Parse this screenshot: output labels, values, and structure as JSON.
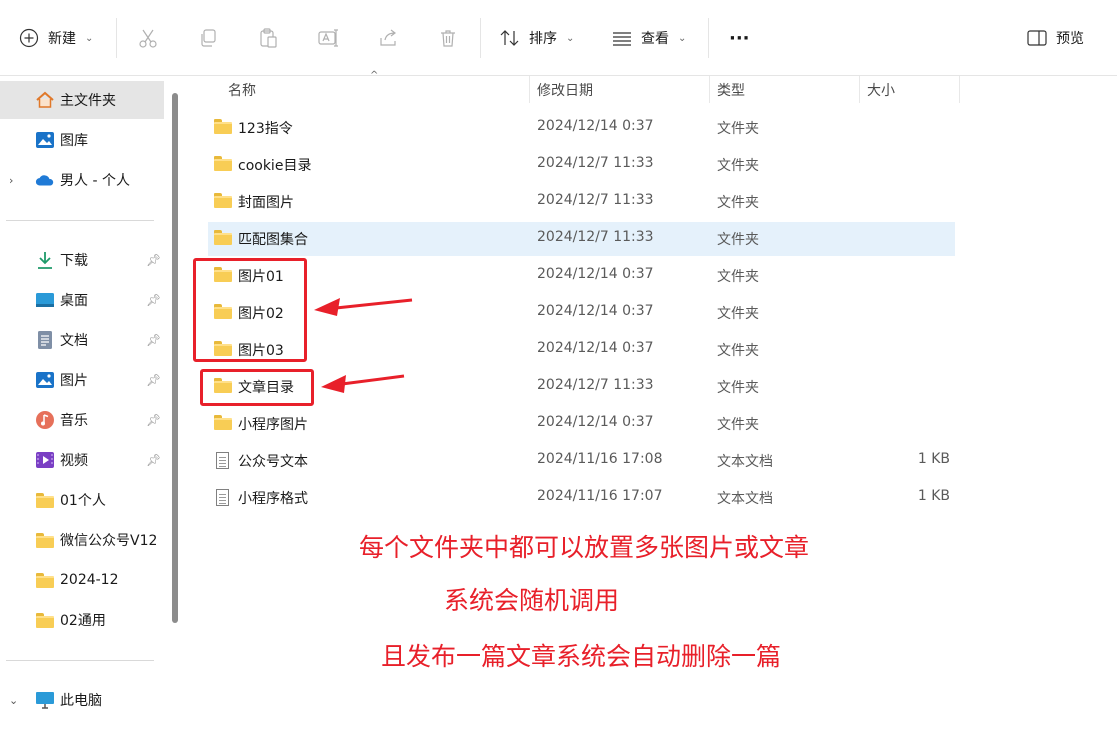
{
  "toolbar": {
    "new_label": "新建",
    "sort_label": "排序",
    "view_label": "查看",
    "more_label": "···",
    "preview_label": "预览"
  },
  "sidebar": {
    "items": [
      {
        "label": "主文件夹",
        "icon": "home-icon"
      },
      {
        "label": "图库",
        "icon": "gallery-icon"
      },
      {
        "label": "男人 - 个人",
        "icon": "cloud-icon"
      },
      {
        "label": "下载",
        "icon": "download-icon"
      },
      {
        "label": "桌面",
        "icon": "desktop-icon"
      },
      {
        "label": "文档",
        "icon": "document-icon"
      },
      {
        "label": "图片",
        "icon": "pictures-icon"
      },
      {
        "label": "音乐",
        "icon": "music-icon"
      },
      {
        "label": "视频",
        "icon": "video-icon"
      },
      {
        "label": "01个人",
        "icon": "folder-icon"
      },
      {
        "label": "微信公众号V12",
        "icon": "folder-icon"
      },
      {
        "label": "2024-12",
        "icon": "folder-icon"
      },
      {
        "label": "02通用",
        "icon": "folder-icon"
      },
      {
        "label": "此电脑",
        "icon": "computer-icon"
      }
    ]
  },
  "columns": {
    "name": "名称",
    "modified": "修改日期",
    "type": "类型",
    "size": "大小"
  },
  "files": [
    {
      "name": "123指令",
      "date": "2024/12/14 0:37",
      "type": "文件夹",
      "size": "",
      "kind": "folder"
    },
    {
      "name": "cookie目录",
      "date": "2024/12/7 11:33",
      "type": "文件夹",
      "size": "",
      "kind": "folder"
    },
    {
      "name": "封面图片",
      "date": "2024/12/7 11:33",
      "type": "文件夹",
      "size": "",
      "kind": "folder"
    },
    {
      "name": "匹配图集合",
      "date": "2024/12/7 11:33",
      "type": "文件夹",
      "size": "",
      "kind": "folder"
    },
    {
      "name": "图片01",
      "date": "2024/12/14 0:37",
      "type": "文件夹",
      "size": "",
      "kind": "folder"
    },
    {
      "name": "图片02",
      "date": "2024/12/14 0:37",
      "type": "文件夹",
      "size": "",
      "kind": "folder"
    },
    {
      "name": "图片03",
      "date": "2024/12/14 0:37",
      "type": "文件夹",
      "size": "",
      "kind": "folder"
    },
    {
      "name": "文章目录",
      "date": "2024/12/7 11:33",
      "type": "文件夹",
      "size": "",
      "kind": "folder"
    },
    {
      "name": "小程序图片",
      "date": "2024/12/14 0:37",
      "type": "文件夹",
      "size": "",
      "kind": "folder"
    },
    {
      "name": "公众号文本",
      "date": "2024/11/16 17:08",
      "type": "文本文档",
      "size": "1 KB",
      "kind": "text"
    },
    {
      "name": "小程序格式",
      "date": "2024/11/16 17:07",
      "type": "文本文档",
      "size": "1 KB",
      "kind": "text"
    }
  ],
  "annotations": {
    "line1": "每个文件夹中都可以放置多张图片或文章",
    "line2": "系统会随机调用",
    "line3": "且发布一篇文章系统会自动删除一篇"
  },
  "colors": {
    "annotation_red": "#e8202a",
    "selection_blue": "#e5f1fb",
    "folder_yellow": "#f8cd55"
  }
}
